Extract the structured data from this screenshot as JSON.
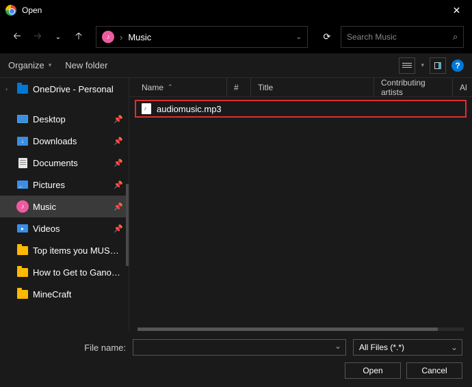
{
  "window": {
    "title": "Open"
  },
  "nav": {
    "breadcrumb": "Music",
    "search_placeholder": "Search Music"
  },
  "toolbar": {
    "organize": "Organize",
    "new_folder": "New folder"
  },
  "sidebar": {
    "items": [
      {
        "label": "OneDrive - Personal",
        "icon": "cloud",
        "expandable": true
      },
      {
        "separator": true
      },
      {
        "label": "Desktop",
        "icon": "desktop",
        "pinned": true
      },
      {
        "label": "Downloads",
        "icon": "download",
        "pinned": true
      },
      {
        "label": "Documents",
        "icon": "document",
        "pinned": true
      },
      {
        "label": "Pictures",
        "icon": "image",
        "pinned": true
      },
      {
        "label": "Music",
        "icon": "music",
        "pinned": true,
        "active": true
      },
      {
        "label": "Videos",
        "icon": "video",
        "pinned": true
      },
      {
        "label": "Top items you MUST get t",
        "icon": "folder"
      },
      {
        "label": "How to Get to Ganondorf",
        "icon": "folder"
      },
      {
        "label": "MineCraft",
        "icon": "folder"
      }
    ]
  },
  "columns": {
    "name": "Name",
    "num": "#",
    "title": "Title",
    "artist": "Contributing artists",
    "last": "Al"
  },
  "files": [
    {
      "name": "audiomusic.mp3"
    }
  ],
  "footer": {
    "filename_label": "File name:",
    "filename_value": "",
    "filetype": "All Files (*.*)",
    "open": "Open",
    "cancel": "Cancel"
  }
}
